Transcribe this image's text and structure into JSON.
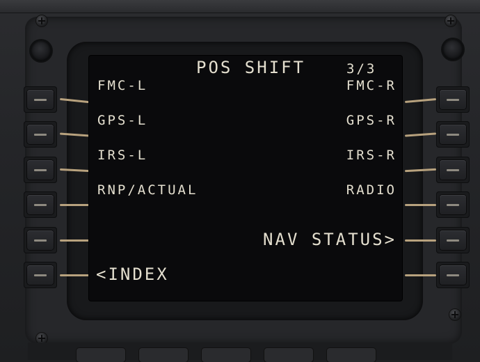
{
  "display": {
    "title": "POS SHIFT",
    "page": "3/3",
    "left": [
      {
        "label": "FMC-L"
      },
      {
        "label": "GPS-L"
      },
      {
        "label": "IRS-L"
      },
      {
        "label": "RNP/ACTUAL"
      },
      {
        "label": ""
      },
      {
        "label": "<INDEX"
      }
    ],
    "right": [
      {
        "label": "FMC-R"
      },
      {
        "label": "GPS-R"
      },
      {
        "label": "IRS-R"
      },
      {
        "label": "RADIO"
      },
      {
        "label": "NAV STATUS>"
      },
      {
        "label": ""
      }
    ]
  },
  "colors": {
    "text": "#e4dfcf",
    "screen": "#0a0a0c",
    "bezel": "#26272a",
    "tick": "#b8a27e"
  }
}
